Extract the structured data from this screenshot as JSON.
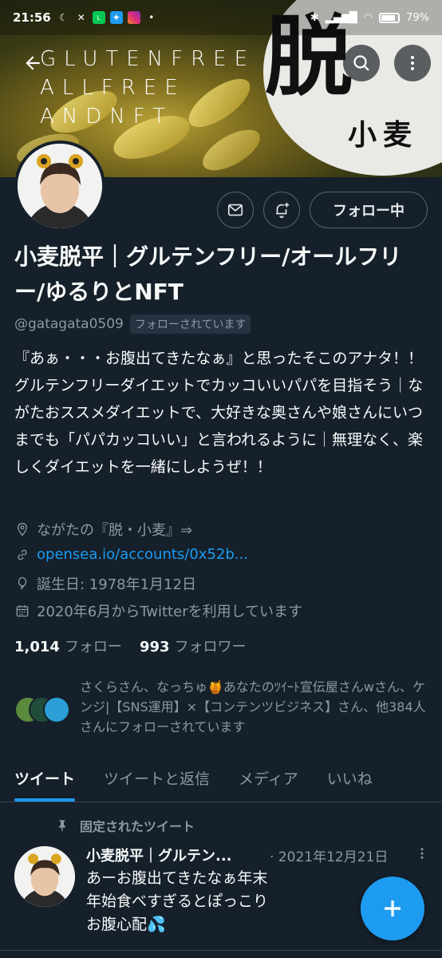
{
  "status_bar": {
    "time": "21:56",
    "battery": "79%"
  },
  "banner": {
    "line1": "GLUTENFREE",
    "line2": "ALLFREE",
    "line3": "ANDNFT",
    "kanji_big": "脱",
    "kanji_small": "小麦"
  },
  "actions": {
    "follow_label": "フォロー中"
  },
  "profile": {
    "name": "小麦脱平｜グルテンフリー/オールフリー/ゆるりとNFT",
    "handle": "@gatagata0509",
    "follows_you": "フォローされています",
    "bio": "『あぁ・・・お腹出てきたなぁ』と思ったそこのアナタ！！ グルテンフリーダイエットでカッコいいパパを目指そう｜ながたおススメダイエットで、大好きな奥さんや娘さんにいつまでも「パパカッコいい」と言われるように｜無理なく、楽しくダイエットを一緒にしようぜ！！",
    "location": "ながたの『脱・小麦』⇒",
    "website": "opensea.io/accounts/0x52b...",
    "birthday": "誕生日: 1978年1月12日",
    "joined": "2020年6月からTwitterを利用しています",
    "following_count": "1,014",
    "following_label": "フォロー",
    "followers_count": "993",
    "followers_label": "フォロワー",
    "followed_by": "さくらさん、なっちゅ🍯あなたのﾂｲｰﾄ宣伝屋さんwさん、ケンジ|【SNS運用】×【コンテンツビジネス】さん、他384人さんにフォローされています"
  },
  "tabs": [
    {
      "label": "ツイート",
      "active": true
    },
    {
      "label": "ツイートと返信",
      "active": false
    },
    {
      "label": "メディア",
      "active": false
    },
    {
      "label": "いいね",
      "active": false
    }
  ],
  "pinned_tweet": {
    "pinned_label": "固定されたツイート",
    "author": "小麦脱平｜グルテン...",
    "date": "· 2021年12月21日",
    "text": "あーお腹出てきたなぁ年末年始食べすぎるとぽっこりお腹心配💦"
  },
  "colors": {
    "background": "#15202b",
    "accent": "#1d9bf0",
    "secondary_text": "#8b98a5"
  }
}
